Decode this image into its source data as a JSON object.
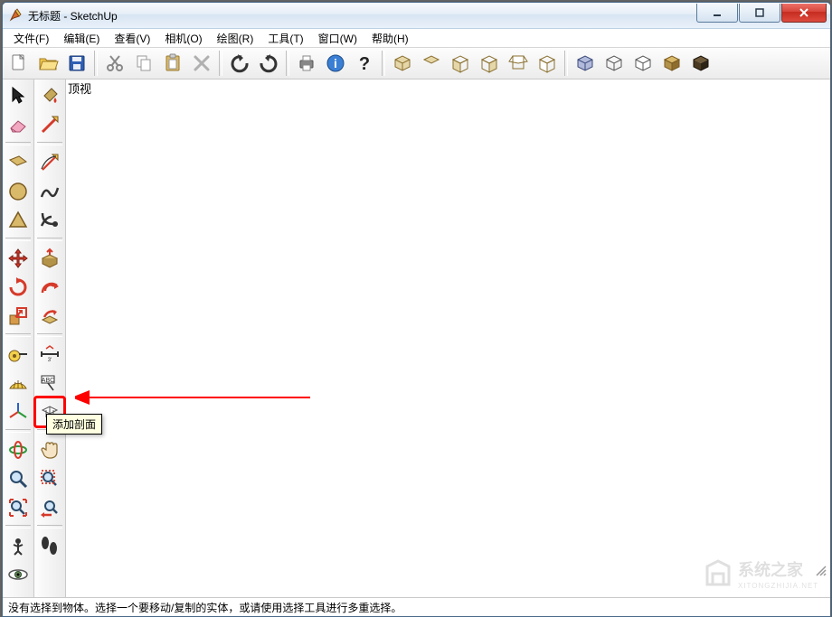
{
  "window": {
    "title": "无标题 - SketchUp"
  },
  "menu": {
    "file": "文件(F)",
    "edit": "编辑(E)",
    "view": "查看(V)",
    "camera": "相机(O)",
    "draw": "绘图(R)",
    "tools": "工具(T)",
    "window": "窗口(W)",
    "help": "帮助(H)"
  },
  "viewport": {
    "label": "顶视"
  },
  "tooltip": {
    "section": "添加剖面"
  },
  "status": {
    "text": "没有选择到物体。选择一个要移动/复制的实体，或请使用选择工具进行多重选择。"
  },
  "colors": {
    "highlight": "#ff0000"
  }
}
